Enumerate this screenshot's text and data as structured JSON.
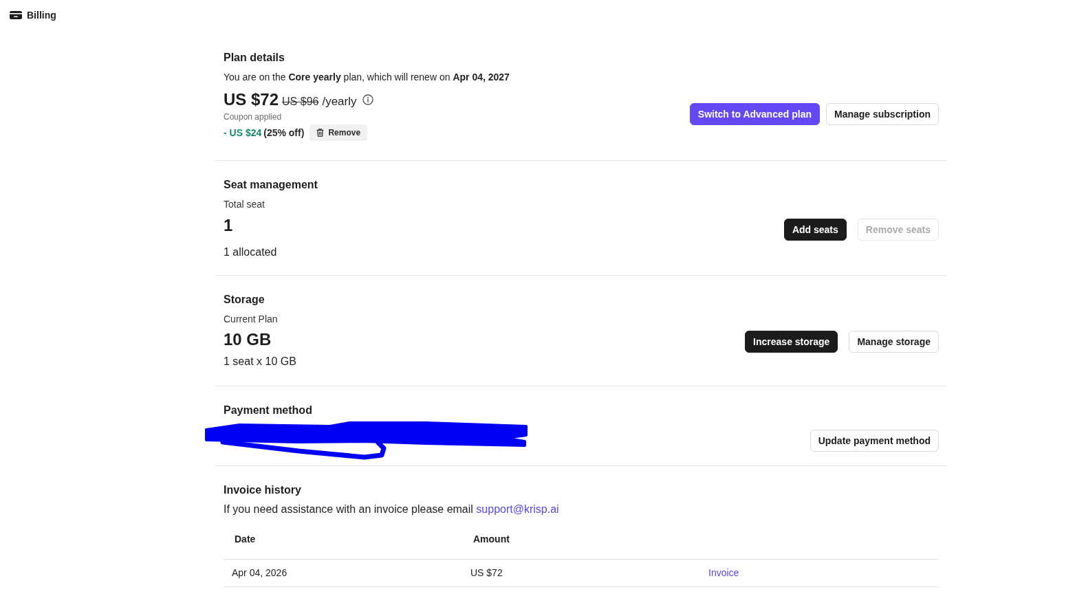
{
  "header": {
    "title": "Billing"
  },
  "plan_details": {
    "title": "Plan details",
    "description": "You are on the **Core yearly** plan, which will renew on **Apr 04, 2027**",
    "price": "US $72",
    "original_price": "US $96",
    "period": "/yearly",
    "coupon_label": "Coupon applied",
    "discount": "- US $24",
    "discount_percent": "(25% off)",
    "remove_button": "Remove",
    "buttons": [
      {
        "label": "Switch to Advanced plan",
        "kind": "primary",
        "disabled": false
      },
      {
        "label": "Manage subscription",
        "kind": "outline",
        "disabled": false
      }
    ]
  },
  "seat_management": {
    "title": "Seat management",
    "label": "Total seat",
    "value": "1",
    "note": "1 allocated",
    "buttons": [
      {
        "label": "Add seats",
        "kind": "dark",
        "disabled": false
      },
      {
        "label": "Remove seats",
        "kind": "outline",
        "disabled": true
      }
    ]
  },
  "storage": {
    "title": "Storage",
    "label": "Current Plan",
    "value": "10 GB",
    "note": "1 seat x 10 GB",
    "buttons": [
      {
        "label": "Increase storage",
        "kind": "dark",
        "disabled": false
      },
      {
        "label": "Manage storage",
        "kind": "outline",
        "disabled": false
      }
    ]
  },
  "payment_method": {
    "title": "Payment method",
    "buttons": [
      {
        "label": "Update payment method",
        "kind": "outline",
        "disabled": false
      }
    ]
  },
  "invoice_history": {
    "title": "Invoice history",
    "help_text": "If you need assistance with an invoice please email",
    "email_link": "support@krisp.ai",
    "table": {
      "columns": [
        "Date",
        "Amount"
      ],
      "rows": [
        {
          "date": "Apr 04, 2026",
          "amount": "US $72",
          "invoice_link": "Invoice"
        }
      ]
    }
  }
}
